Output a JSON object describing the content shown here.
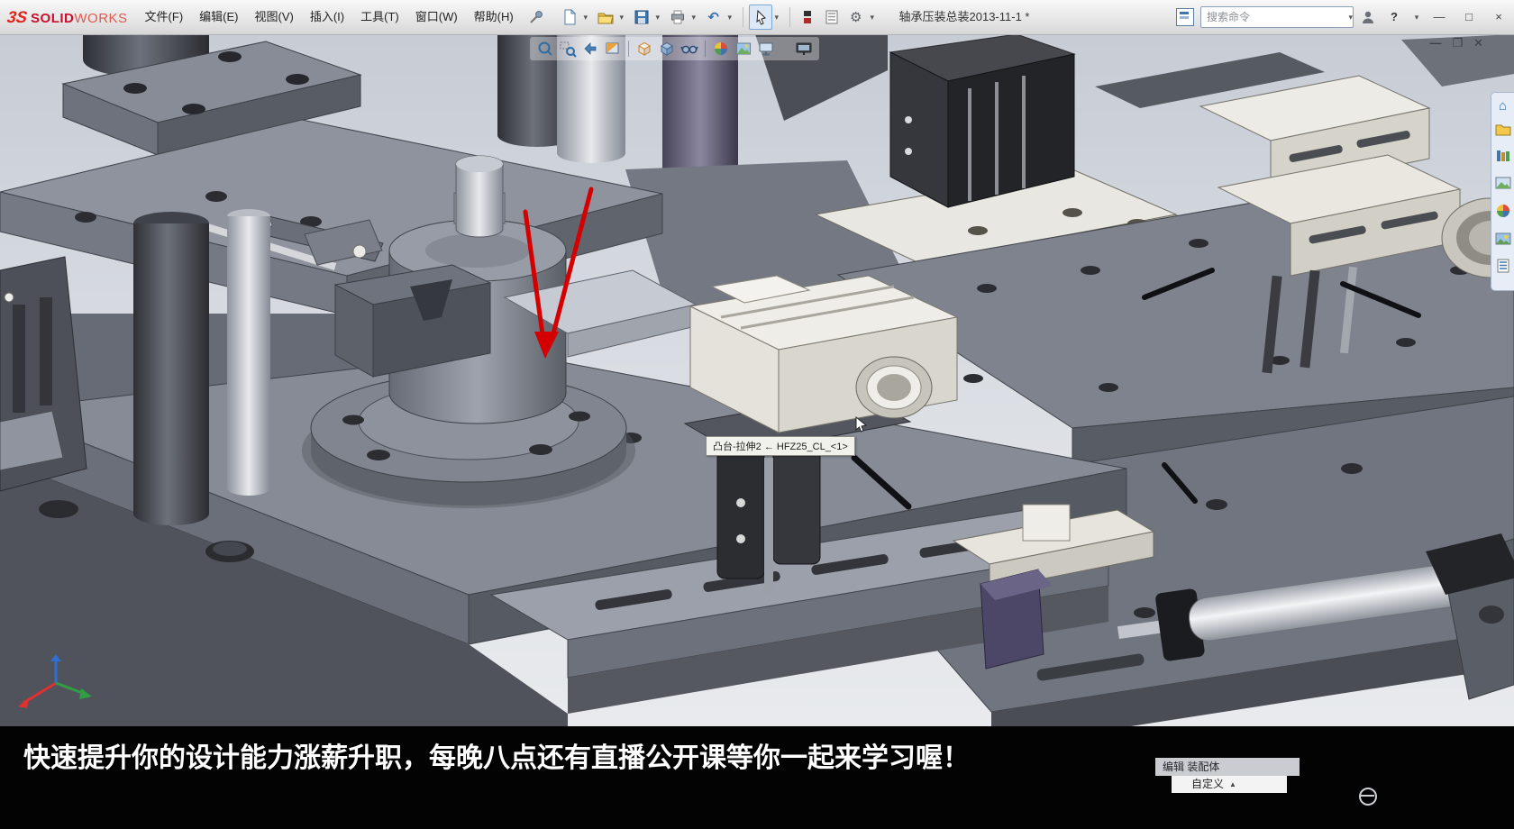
{
  "window": {
    "logo_mark": "3S",
    "brand_solid": "SOLID",
    "brand_works": "WORKS",
    "doc_title": "轴承压装总装2013-11-1 *"
  },
  "menu": {
    "items": [
      {
        "label": "文件(F)"
      },
      {
        "label": "编辑(E)"
      },
      {
        "label": "视图(V)"
      },
      {
        "label": "插入(I)"
      },
      {
        "label": "工具(T)"
      },
      {
        "label": "窗口(W)"
      },
      {
        "label": "帮助(H)"
      }
    ]
  },
  "search": {
    "placeholder": "搜索命令"
  },
  "glyphs": {
    "caret": "▾",
    "minimize": "—",
    "restore": "□",
    "close": "×",
    "child_minimize": "—",
    "child_restore": "❐",
    "child_close": "✕",
    "help": "?",
    "gear": "⚙",
    "home": "⌂",
    "undo": "↶",
    "up_triangle": "▲"
  },
  "viewport": {
    "tooltip": "凸台-拉伸2 ← HFZ25_CL_<1>"
  },
  "banner": {
    "text": "快速提升你的设计能力涨薪升职，每晚八点还有直播公开课等你一起来学习喔！"
  },
  "status": {
    "editing": "编辑 装配体",
    "custom": "自定义"
  }
}
